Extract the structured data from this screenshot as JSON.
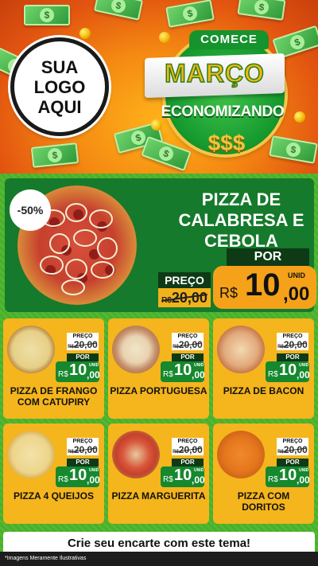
{
  "header": {
    "logo_lines": [
      "SUA",
      "LOGO",
      "AQUI"
    ],
    "badge_top": "COMECE",
    "badge_main": "MARÇO",
    "badge_sub": "ECONOMIZANDO",
    "badge_symbols": "$$$",
    "bill_symbol": "$"
  },
  "featured": {
    "discount": "-50%",
    "name_lines": [
      "PIZZA DE",
      "CALABRESA E",
      "CEBOLA"
    ],
    "preco_label": "PREÇO",
    "old_currency": "R$",
    "old_price": "20,00",
    "por_label": "POR",
    "unit_label": "UNID",
    "new_currency": "R$",
    "new_whole": "10",
    "new_cents": ",00"
  },
  "products": [
    {
      "name": "PIZZA DE FRANGO COM CATUPIRY",
      "preco_label": "PREÇO",
      "old_currency": "R$",
      "old_price": "20,00",
      "por_label": "POR",
      "unit_label": "UNID",
      "new_currency": "R$",
      "new_whole": "10",
      "new_cents": ",00"
    },
    {
      "name": "PIZZA PORTUGUESA",
      "preco_label": "PREÇO",
      "old_currency": "R$",
      "old_price": "20,00",
      "por_label": "POR",
      "unit_label": "UNID",
      "new_currency": "R$",
      "new_whole": "10",
      "new_cents": ",00"
    },
    {
      "name": "PIZZA DE BACON",
      "preco_label": "PREÇO",
      "old_currency": "R$",
      "old_price": "20,00",
      "por_label": "POR",
      "unit_label": "UNID",
      "new_currency": "R$",
      "new_whole": "10",
      "new_cents": ",00"
    },
    {
      "name": "PIZZA 4 QUEIJOS",
      "preco_label": "PREÇO",
      "old_currency": "R$",
      "old_price": "20,00",
      "por_label": "POR",
      "unit_label": "UNID",
      "new_currency": "R$",
      "new_whole": "10",
      "new_cents": ",00"
    },
    {
      "name": "PIZZA MARGUERITA",
      "preco_label": "PREÇO",
      "old_currency": "R$",
      "old_price": "20,00",
      "por_label": "POR",
      "unit_label": "UNID",
      "new_currency": "R$",
      "new_whole": "10",
      "new_cents": ",00"
    },
    {
      "name": "PIZZA COM DORITOS",
      "preco_label": "PREÇO",
      "old_currency": "R$",
      "old_price": "20,00",
      "por_label": "POR",
      "unit_label": "UNID",
      "new_currency": "R$",
      "new_whole": "10",
      "new_cents": ",00"
    }
  ],
  "cta": "Crie seu encarte com este tema!",
  "footer_note": "*Imagens Meramente Ilustrativas",
  "colors": {
    "header_orange": "#f58a12",
    "green_bg": "#4aaf2a",
    "dark_green": "#157a2b",
    "card_yellow": "#f5b51c",
    "price_green": "#16882e"
  }
}
